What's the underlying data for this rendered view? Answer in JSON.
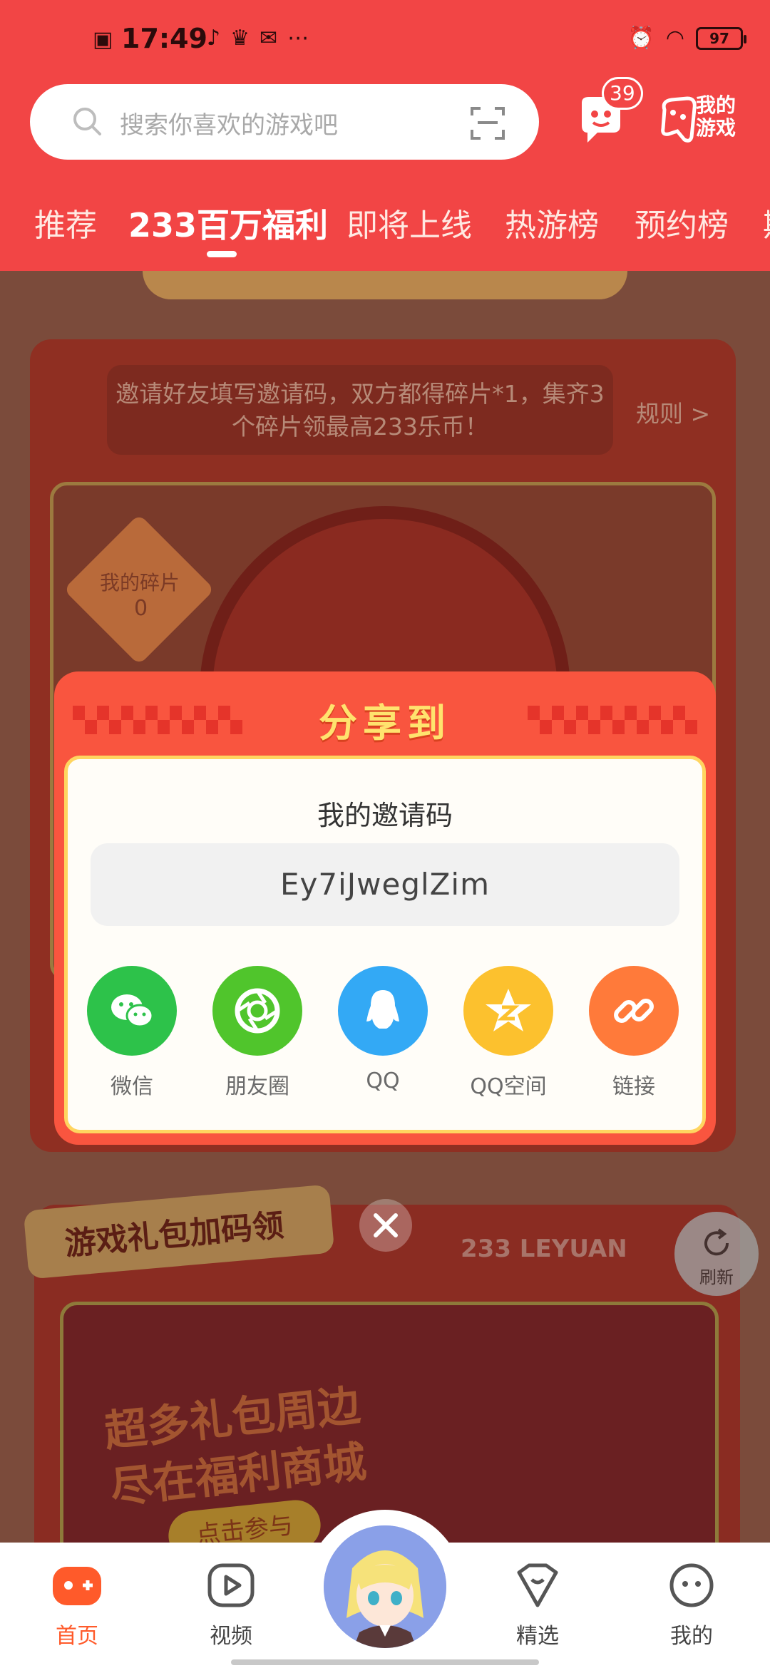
{
  "status_bar": {
    "time": "17:49",
    "battery": "97"
  },
  "search": {
    "placeholder": "搜索你喜欢的游戏吧"
  },
  "header": {
    "message_badge": "39",
    "my_games_line1": "我的",
    "my_games_line2": "游戏"
  },
  "tabs": [
    {
      "label": "推荐"
    },
    {
      "label": "233百万福利"
    },
    {
      "label": "即将上线"
    },
    {
      "label": "热游榜"
    },
    {
      "label": "预约榜"
    },
    {
      "label": "期"
    }
  ],
  "background": {
    "note": "邀请好友填写邀请码，双方都得碎片*1，集齐3个碎片领最高233乐币！",
    "rules": "规则 >",
    "my_pieces_label": "我的碎片",
    "my_pieces_count": "0",
    "gift_ribbon": "游戏礼包加码领",
    "leyuan": "233 LEYUAN",
    "ad_line1": "超多礼包周边",
    "ad_line2": "尽在福利商城",
    "ad_button": "点击参与"
  },
  "modal": {
    "title": "分享到",
    "invite_label": "我的邀请码",
    "invite_code": "Ey7iJweglZim",
    "share_targets": [
      {
        "label": "微信",
        "color": "#2dc24a",
        "icon": "wechat-icon"
      },
      {
        "label": "朋友圈",
        "color": "#50c52c",
        "icon": "moments-icon"
      },
      {
        "label": "QQ",
        "color": "#33a9f5",
        "icon": "qq-icon"
      },
      {
        "label": "QQ空间",
        "color": "#fcc12e",
        "icon": "qzone-icon"
      },
      {
        "label": "链接",
        "color": "#ff7a3a",
        "icon": "link-icon"
      }
    ]
  },
  "refresh": {
    "label": "刷新"
  },
  "bottom_nav": [
    {
      "label": "首页",
      "active": true
    },
    {
      "label": "视频",
      "active": false
    },
    {
      "label": "精选",
      "active": false
    },
    {
      "label": "我的",
      "active": false
    }
  ],
  "colors": {
    "header_red": "#f24545",
    "modal_red": "#f9553f",
    "accent_orange": "#ff5a2a"
  }
}
